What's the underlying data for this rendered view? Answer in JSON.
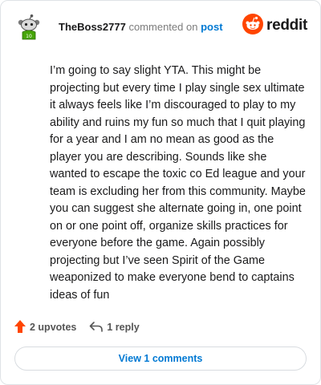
{
  "header": {
    "username": "TheBoss2777",
    "action_text": "commented on",
    "post_link": "post",
    "brand": "reddit"
  },
  "comment": {
    "body": "I’m going to say slight YTA. This might be projecting but every time I play single sex ultimate it always feels like I’m discouraged to play to my ability and ruins my fun so much that I quit playing for a year and I am no mean as good as the player you are describing. Sounds like she wanted to escape the toxic co Ed league and your team is excluding her from this community. Maybe you can suggest she alternate going in, one point on or one point off, organize skills practices for everyone before the game. Again possibly projecting but I’ve seen Spirit of the Game weaponized to make everyone bend to captains ideas of fun"
  },
  "actions": {
    "upvotes": "2 upvotes",
    "replies": "1 reply",
    "view_comments": "View 1 comments"
  },
  "icons": {
    "avatar": "snoo-avatar-icon",
    "logo": "reddit-logo-icon",
    "upvote": "upvote-arrow-icon",
    "reply": "reply-arrow-icon"
  },
  "colors": {
    "brand_orange": "#ff4500",
    "upvote_orange": "#ff4500",
    "link_blue": "#0079d3",
    "avatar_green": "#46a508"
  }
}
